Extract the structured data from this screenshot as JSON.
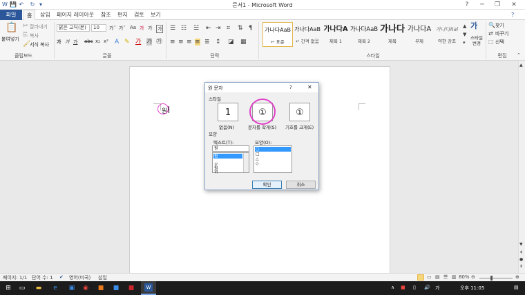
{
  "window": {
    "title": "문서1 - Microsoft Word",
    "help": "?",
    "min": "─",
    "restore": "❐",
    "close": "✕"
  },
  "quick_access": {
    "save": "💾",
    "undo": "↶",
    "redo": "↻",
    "more": "▾"
  },
  "tabs": [
    "파일",
    "홈",
    "삽입",
    "페이지 레이아웃",
    "참조",
    "편지",
    "검토",
    "보기"
  ],
  "ribbon": {
    "clipboard": {
      "paste": "붙여넣기",
      "cut": "잘라내기",
      "copy": "복사",
      "format_painter": "서식 복사",
      "label": "클립보드"
    },
    "font": {
      "name": "맑은 고딕(본)",
      "size": "10",
      "bold": "가",
      "italic": "가",
      "underline": "가",
      "strike": "abc",
      "sub": "x₂",
      "sup": "x²",
      "grow": "가ˆ",
      "shrink": "가ˇ",
      "case": "Aa",
      "clear": "가",
      "phonetic": "가",
      "border_char": "가",
      "label": "글꼴"
    },
    "paragraph": {
      "label": "단락"
    },
    "styles": {
      "label": "스타일",
      "items": [
        {
          "sample": "가나다AaB",
          "name": "↵ 표준"
        },
        {
          "sample": "가나다AaB",
          "name": "↵ 간격 없음"
        },
        {
          "sample": "가나다A",
          "name": "제목 1"
        },
        {
          "sample": "가나다AaB",
          "name": "제목 2"
        },
        {
          "sample": "가나다",
          "name": "제목"
        },
        {
          "sample": "가나다A",
          "name": "부제"
        },
        {
          "sample": "가나다AaI",
          "name": "약한 강조"
        }
      ],
      "change": "스타일 변경"
    },
    "editing": {
      "find": "찾기",
      "replace": "바꾸기",
      "select": "선택",
      "label": "편집"
    }
  },
  "document": {
    "char_text": "원"
  },
  "dialog": {
    "title": "원 문자",
    "help": "?",
    "close": "✕",
    "style_label": "스타일",
    "options": [
      {
        "glyph": "1",
        "label": "없음(N)"
      },
      {
        "glyph": "①",
        "label": "문자를 작게(S)"
      },
      {
        "glyph": "①",
        "label": "기호를 크게(E)"
      }
    ],
    "shape_section": "모양",
    "text_label": "텍스트(T):",
    "text_value": "원",
    "text_list": [
      "원",
      "",
      "우",
      "원",
      "위"
    ],
    "shape_label": "모양(O):",
    "shape_list": [
      "○",
      "□",
      "△",
      "◇"
    ],
    "ok": "확인",
    "cancel": "취소"
  },
  "status": {
    "page": "페이지: 1/1",
    "words": "단어 수: 1",
    "language": "영어(미국)",
    "mode": "삽입",
    "zoom": "80%"
  },
  "taskbar": {
    "time": "오후 11:05",
    "ime": "가"
  },
  "colors": {
    "accent": "#2b579a",
    "highlight_circle": "#e040c8",
    "selection": "#3399ff"
  }
}
